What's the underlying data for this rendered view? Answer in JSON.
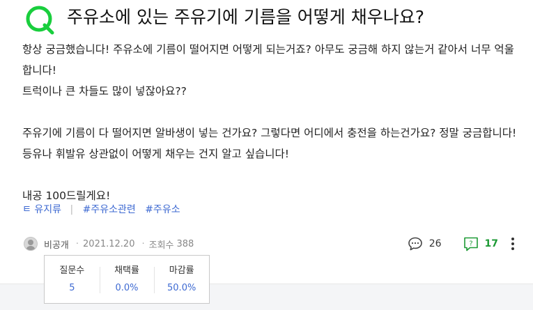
{
  "question": {
    "title": "주유소에 있는 주유기에 기름을 어떻게 채우나요?",
    "body": [
      "항상 궁금했습니다! 주유소에 기름이 떨어지면 어떻게 되는거죠? 아무도 궁금해 하지 않는거 같아서 너무 억울합니다!",
      "트럭이나 큰 차들도 많이 넣잖아요??",
      "",
      "주유기에 기름이 다 떨어지면 알바생이 넣는 건가요? 그렇다면 어디에서 충전을 하는건가요? 정말 궁금합니다! 등유나 휘발유 상관없이 어떻게 채우는 건지 알고 싶습니다!",
      "",
      "내공 100드릴게요!"
    ]
  },
  "tags": {
    "category": "ㅌ 유지류",
    "items": [
      "#주유소관련",
      "#주유소"
    ]
  },
  "meta": {
    "author": "비공개",
    "date": "2021.12.20",
    "views_label": "조회수",
    "views": "388"
  },
  "actions": {
    "comment_count": "26",
    "answer_count": "17",
    "answer_color": "#1d9a35"
  },
  "stats_popup": {
    "items": [
      {
        "label": "질문수",
        "value": "5"
      },
      {
        "label": "채택률",
        "value": "0.0%"
      },
      {
        "label": "마감률",
        "value": "50.0%"
      }
    ]
  },
  "colors": {
    "q_logo": "#19ce3d",
    "tag_link": "#3e6ad2"
  }
}
